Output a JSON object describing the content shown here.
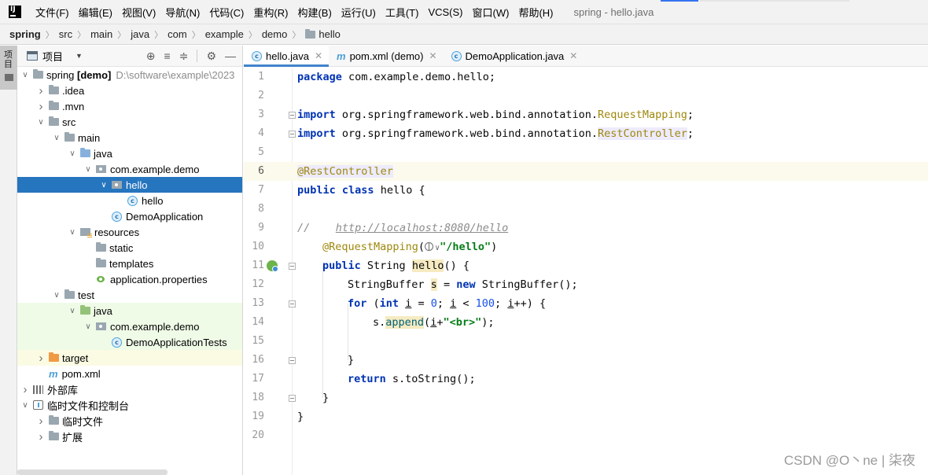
{
  "menubar": {
    "items": [
      "文件(F)",
      "编辑(E)",
      "视图(V)",
      "导航(N)",
      "代码(C)",
      "重构(R)",
      "构建(B)",
      "运行(U)",
      "工具(T)",
      "VCS(S)",
      "窗口(W)",
      "帮助(H)"
    ],
    "window_title": "spring - hello.java"
  },
  "breadcrumb": [
    "spring",
    "src",
    "main",
    "java",
    "com",
    "example",
    "demo",
    "hello"
  ],
  "left_stripe": {
    "label": "项目"
  },
  "project_panel": {
    "title": "项目",
    "tools": {
      "locate": "⊕",
      "expand": "≡",
      "collapse": "≑",
      "settings": "⚙",
      "hide": "—"
    },
    "tree": [
      {
        "label": "spring [demo]",
        "hint": "D:\\software\\example\\2023",
        "arrow": "down",
        "depth": 0,
        "icon": "module-folder",
        "bold_part": "[demo]"
      },
      {
        "label": ".idea",
        "arrow": "right",
        "depth": 1,
        "icon": "folder"
      },
      {
        "label": ".mvn",
        "arrow": "right",
        "depth": 1,
        "icon": "folder"
      },
      {
        "label": "src",
        "arrow": "down",
        "depth": 1,
        "icon": "folder"
      },
      {
        "label": "main",
        "arrow": "down",
        "depth": 2,
        "icon": "folder"
      },
      {
        "label": "java",
        "arrow": "down",
        "depth": 3,
        "icon": "source-folder"
      },
      {
        "label": "com.example.demo",
        "arrow": "down",
        "depth": 4,
        "icon": "package"
      },
      {
        "label": "hello",
        "arrow": "down",
        "depth": 5,
        "icon": "package",
        "selected": true
      },
      {
        "label": "hello",
        "arrow": "none",
        "depth": 6,
        "icon": "class"
      },
      {
        "label": "DemoApplication",
        "arrow": "none",
        "depth": 5,
        "icon": "spring-class"
      },
      {
        "label": "resources",
        "arrow": "down",
        "depth": 3,
        "icon": "resources-folder"
      },
      {
        "label": "static",
        "arrow": "none",
        "depth": 4,
        "icon": "folder"
      },
      {
        "label": "templates",
        "arrow": "none",
        "depth": 4,
        "icon": "folder"
      },
      {
        "label": "application.properties",
        "arrow": "none",
        "depth": 4,
        "icon": "properties"
      },
      {
        "label": "test",
        "arrow": "down",
        "depth": 2,
        "icon": "folder"
      },
      {
        "label": "java",
        "arrow": "down",
        "depth": 3,
        "icon": "test-folder",
        "bg": "test"
      },
      {
        "label": "com.example.demo",
        "arrow": "down",
        "depth": 4,
        "icon": "package",
        "bg": "test"
      },
      {
        "label": "DemoApplicationTests",
        "arrow": "none",
        "depth": 5,
        "icon": "spring-class",
        "bg": "test"
      },
      {
        "label": "target",
        "arrow": "right",
        "depth": 1,
        "icon": "excluded-folder",
        "bg": "excluded"
      },
      {
        "label": "pom.xml",
        "arrow": "none",
        "depth": 1,
        "icon": "maven"
      },
      {
        "label": "外部库",
        "arrow": "right",
        "depth": 0,
        "icon": "library"
      },
      {
        "label": "临时文件和控制台",
        "arrow": "down",
        "depth": 0,
        "icon": "scratch"
      },
      {
        "label": "临时文件",
        "arrow": "right",
        "depth": 1,
        "icon": "folder"
      },
      {
        "label": "扩展",
        "arrow": "right",
        "depth": 1,
        "icon": "folder"
      }
    ]
  },
  "editor": {
    "tabs": [
      {
        "label": "hello.java",
        "icon": "class",
        "active": true,
        "close": "✕"
      },
      {
        "label": "pom.xml (demo)",
        "icon": "maven",
        "active": false,
        "close": "✕"
      },
      {
        "label": "DemoApplication.java",
        "icon": "spring-class",
        "active": false,
        "close": "✕"
      }
    ],
    "caret_line": 6,
    "lines": [
      {
        "n": "1"
      },
      {
        "n": "2"
      },
      {
        "n": "3"
      },
      {
        "n": "4"
      },
      {
        "n": "5"
      },
      {
        "n": "6"
      },
      {
        "n": "7"
      },
      {
        "n": "8"
      },
      {
        "n": "9"
      },
      {
        "n": "10"
      },
      {
        "n": "11"
      },
      {
        "n": "12"
      },
      {
        "n": "13"
      },
      {
        "n": "14"
      },
      {
        "n": "15"
      },
      {
        "n": "16"
      },
      {
        "n": "17"
      },
      {
        "n": "18"
      },
      {
        "n": "19"
      },
      {
        "n": "20"
      }
    ],
    "code": {
      "l1_kw": "package",
      "l1_rest": " com.example.demo.hello;",
      "l3_kw": "import",
      "l3_path": " org.springframework.web.bind.annotation.",
      "l3_ann": "RequestMapping",
      "l3_end": ";",
      "l4_kw": "import",
      "l4_path": " org.springframework.web.bind.annotation.",
      "l4_ann": "RestController",
      "l4_end": ";",
      "l6_ann": "@RestController",
      "l7_kw1": "public",
      "l7_kw2": "class",
      "l7_rest": " hello {",
      "l9_cmt": "//    ",
      "l9_url": "http://localhost:8080/hello",
      "l10_ann": "@RequestMapping",
      "l10_open": "(",
      "l10_globe_arrow": "∨",
      "l10_str": "\"/hello\"",
      "l10_close": ")",
      "l11_kw": "public",
      "l11_type": " String ",
      "l11_name": "hello",
      "l11_rest": "() {",
      "l12_a": "StringBuffer ",
      "l12_var": "s",
      "l12_b": " = ",
      "l12_kw": "new",
      "l12_c": " StringBuffer();",
      "l13_kw": "for",
      "l13_a": " (",
      "l13_kw2": "int",
      "l13_b": " ",
      "l13_i1": "i",
      "l13_c": " = ",
      "l13_n0": "0",
      "l13_d": "; ",
      "l13_i2": "i",
      "l13_e": " < ",
      "l13_n100": "100",
      "l13_f": "; ",
      "l13_i3": "i",
      "l13_g": "++) {",
      "l14_a": "s.",
      "l14_m": "append",
      "l14_b": "(",
      "l14_i": "i",
      "l14_c": "+",
      "l14_str": "\"<br>\"",
      "l14_d": ");",
      "l16": "}",
      "l17_kw": "return",
      "l17_rest": " s.toString();",
      "l18": "}",
      "l19": "}"
    }
  },
  "watermark": "CSDN @O丶ne | 柒夜"
}
